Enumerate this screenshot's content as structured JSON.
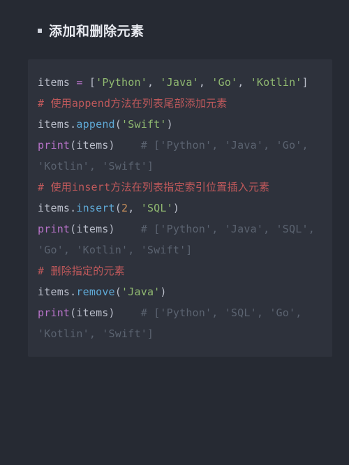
{
  "heading": "添加和删除元素",
  "code_lines": [
    [
      {
        "t": "items ",
        "c": "tok-plain"
      },
      {
        "t": "=",
        "c": "tok-kw"
      },
      {
        "t": " [",
        "c": "tok-plain"
      },
      {
        "t": "'Python'",
        "c": "tok-str"
      },
      {
        "t": ", ",
        "c": "tok-plain"
      },
      {
        "t": "'Java'",
        "c": "tok-str"
      },
      {
        "t": ", ",
        "c": "tok-plain"
      },
      {
        "t": "'Go'",
        "c": "tok-str"
      },
      {
        "t": ", ",
        "c": "tok-plain"
      },
      {
        "t": "'Kotlin'",
        "c": "tok-str"
      },
      {
        "t": "]",
        "c": "tok-plain"
      }
    ],
    [
      {
        "t": "# 使用append方法在列表尾部添加元素",
        "c": "tok-com-h"
      }
    ],
    [
      {
        "t": "items.",
        "c": "tok-plain"
      },
      {
        "t": "append",
        "c": "tok-call"
      },
      {
        "t": "(",
        "c": "tok-plain"
      },
      {
        "t": "'Swift'",
        "c": "tok-str"
      },
      {
        "t": ")",
        "c": "tok-plain"
      }
    ],
    [
      {
        "t": "print",
        "c": "tok-kw"
      },
      {
        "t": "(items)    ",
        "c": "tok-plain"
      },
      {
        "t": "# ['Python', 'Java', 'Go', 'Kotlin', 'Swift']",
        "c": "tok-com"
      }
    ],
    [
      {
        "t": "# 使用insert方法在列表指定索引位置插入元素",
        "c": "tok-com-h"
      }
    ],
    [
      {
        "t": "items.",
        "c": "tok-plain"
      },
      {
        "t": "insert",
        "c": "tok-call"
      },
      {
        "t": "(",
        "c": "tok-plain"
      },
      {
        "t": "2",
        "c": "tok-num"
      },
      {
        "t": ", ",
        "c": "tok-plain"
      },
      {
        "t": "'SQL'",
        "c": "tok-str"
      },
      {
        "t": ")",
        "c": "tok-plain"
      }
    ],
    [
      {
        "t": "print",
        "c": "tok-kw"
      },
      {
        "t": "(items)    ",
        "c": "tok-plain"
      },
      {
        "t": "# ['Python', 'Java', 'SQL', 'Go', 'Kotlin', 'Swift']",
        "c": "tok-com"
      }
    ],
    [
      {
        "t": "# 删除指定的元素",
        "c": "tok-com-h"
      }
    ],
    [
      {
        "t": "items.",
        "c": "tok-plain"
      },
      {
        "t": "remove",
        "c": "tok-call"
      },
      {
        "t": "(",
        "c": "tok-plain"
      },
      {
        "t": "'Java'",
        "c": "tok-str"
      },
      {
        "t": ")",
        "c": "tok-plain"
      }
    ],
    [
      {
        "t": "print",
        "c": "tok-kw"
      },
      {
        "t": "(items)    ",
        "c": "tok-plain"
      },
      {
        "t": "# ['Python', 'SQL', 'Go', 'Kotlin', 'Swift']",
        "c": "tok-com"
      }
    ]
  ]
}
